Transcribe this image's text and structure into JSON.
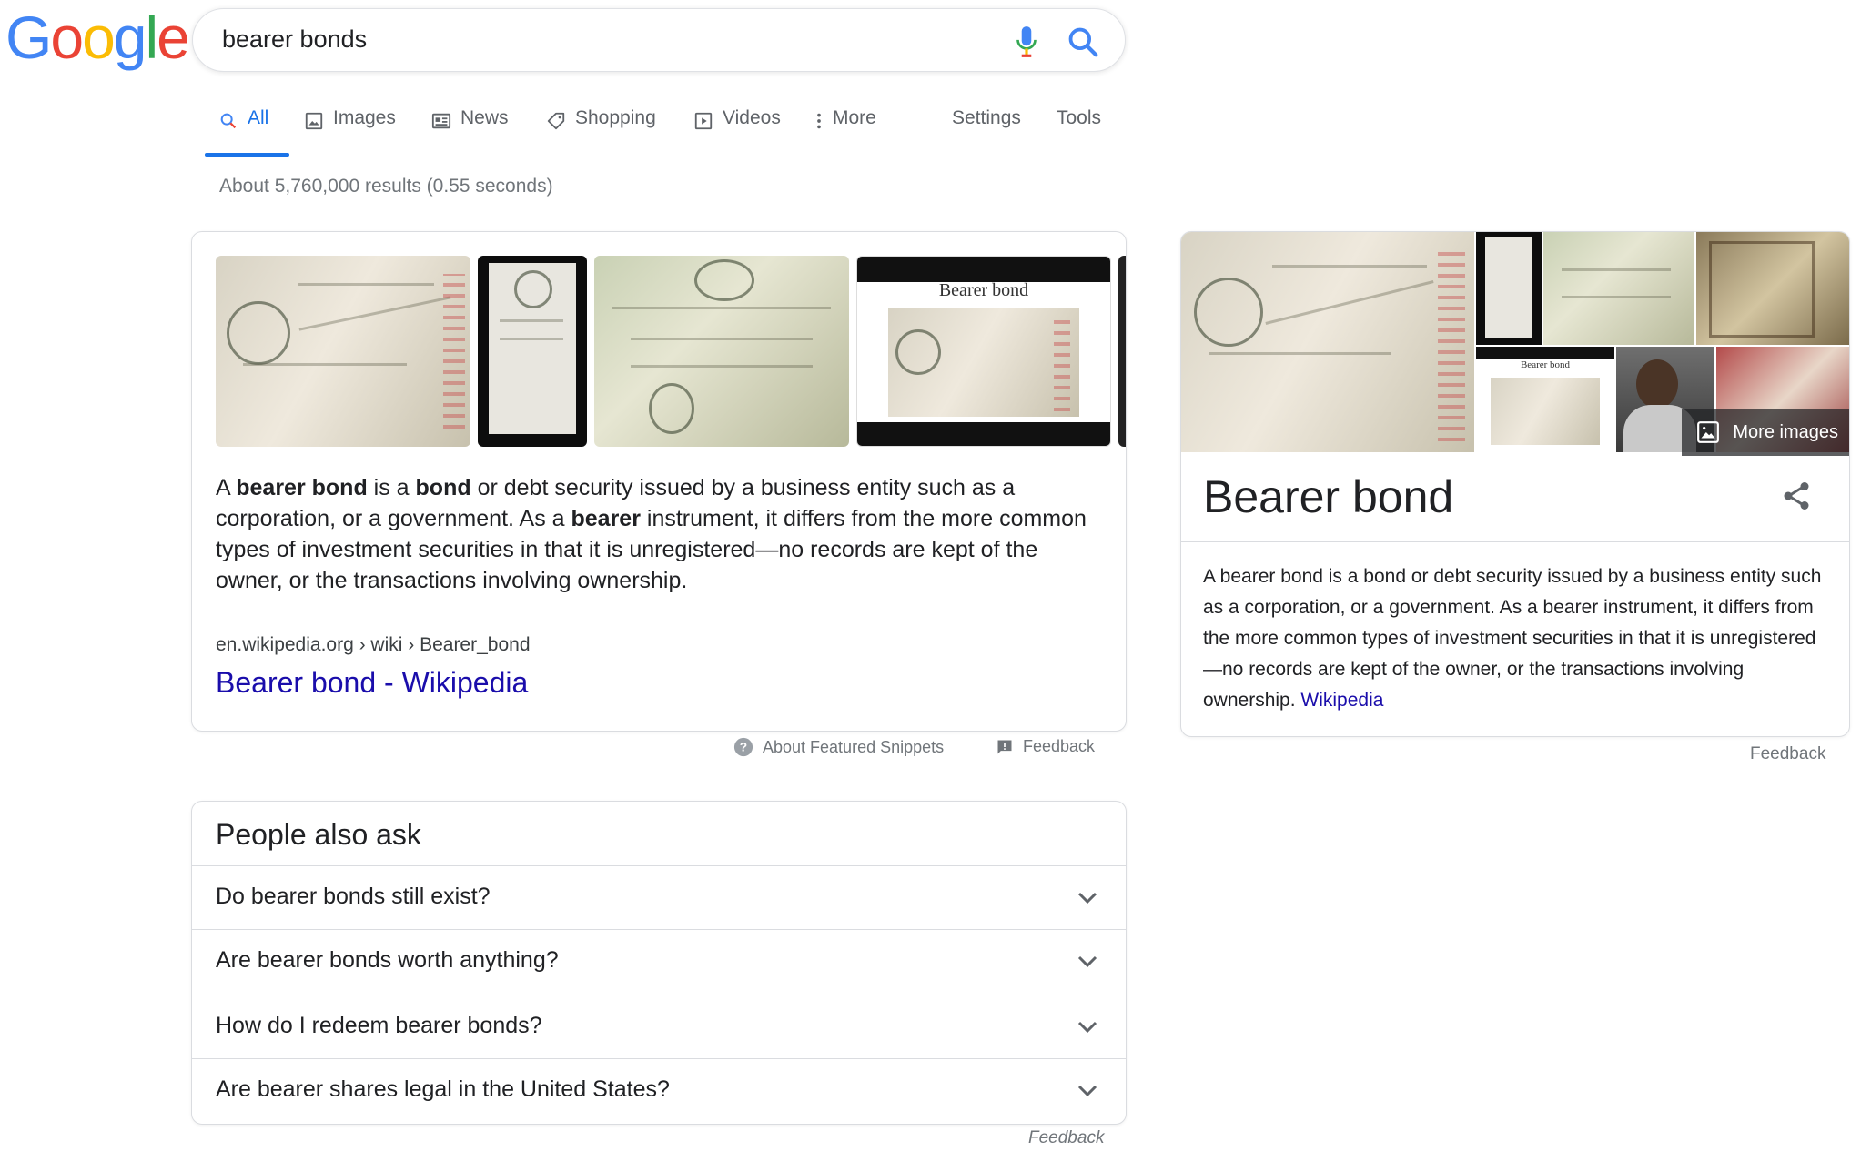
{
  "logo": {
    "letters": [
      "G",
      "o",
      "o",
      "g",
      "l",
      "e"
    ],
    "colors": [
      "#4285F4",
      "#EA4335",
      "#FBBC05",
      "#4285F4",
      "#34A853",
      "#EA4335"
    ]
  },
  "search": {
    "query": "bearer bonds"
  },
  "tabs": [
    {
      "label": "All",
      "icon": "search-icon",
      "active": true
    },
    {
      "label": "Images",
      "icon": "image-icon"
    },
    {
      "label": "News",
      "icon": "news-icon"
    },
    {
      "label": "Shopping",
      "icon": "tag-icon"
    },
    {
      "label": "Videos",
      "icon": "play-icon"
    },
    {
      "label": "More",
      "icon": "dots-vertical-icon"
    },
    {
      "label": "Settings"
    },
    {
      "label": "Tools"
    }
  ],
  "result_stats": "About 5,760,000 results (0.55 seconds)",
  "featured_snippet": {
    "thumb_caption": "Bearer bond",
    "text_parts": [
      "A ",
      "bearer bond",
      " is a ",
      "bond",
      " or debt security issued by a business entity such as a corporation, or a government. As a ",
      "bearer",
      " instrument, it differs from the more common types of investment securities in that it is unregistered—no records are kept of the owner, or the transactions involving ownership."
    ],
    "url": "en.wikipedia.org › wiki › Bearer_bond",
    "link_title": "Bearer bond - Wikipedia",
    "about_label": "About Featured Snippets",
    "feedback_label": "Feedback"
  },
  "people_also_ask": {
    "title": "People also ask",
    "questions": [
      "Do bearer bonds still exist?",
      "Are bearer bonds worth anything?",
      "How do I redeem bearer bonds?",
      "Are bearer shares legal in the United States?"
    ],
    "feedback_label": "Feedback"
  },
  "knowledge_panel": {
    "title": "Bearer bond",
    "more_images_label": "More images",
    "thumb_caption": "Bearer bond",
    "description": "A bearer bond is a bond or debt security issued by a business entity such as a corporation, or a government. As a bearer instrument, it differs from the more common types of investment securities in that it is unregistered—no records are kept of the owner, or the transactions involving ownership. ",
    "source_link": "Wikipedia",
    "feedback_label": "Feedback"
  },
  "colors": {
    "link": "#1a0dab",
    "accent": "#1a73e8",
    "muted": "#70757a"
  }
}
